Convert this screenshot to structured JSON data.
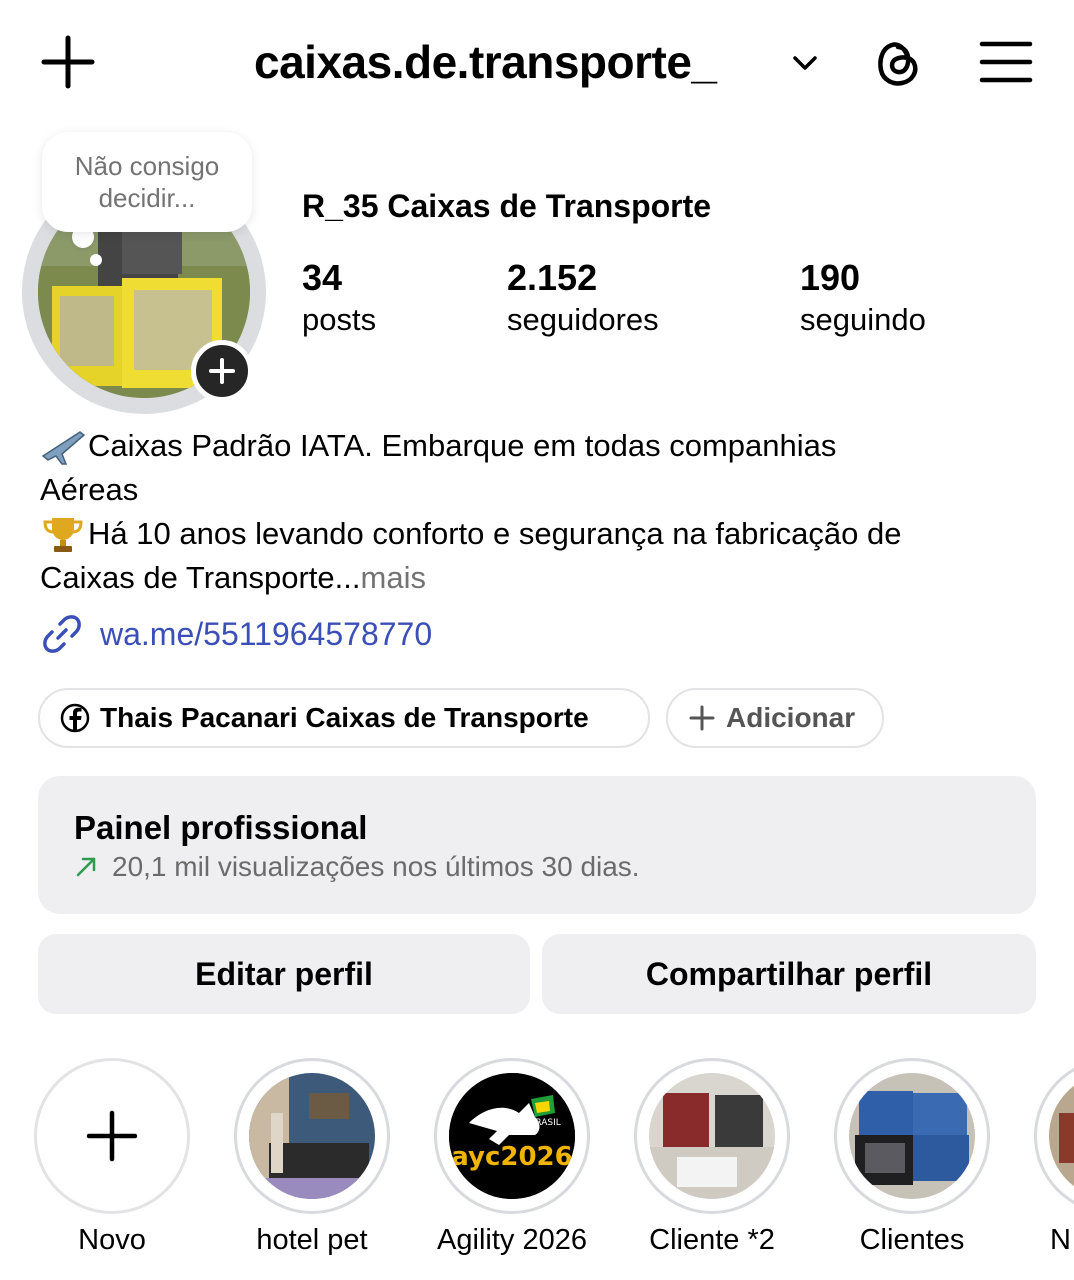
{
  "header": {
    "username": "caixas.de.transporte_",
    "icons": [
      "plus-icon",
      "chevron-down-icon",
      "threads-icon",
      "menu-icon"
    ]
  },
  "profile": {
    "note": "Não consigo decidir...",
    "display_name": "R_35 Caixas de Transporte",
    "stats": [
      {
        "value": "34",
        "label": "posts"
      },
      {
        "value": "2.152",
        "label": "seguidores"
      },
      {
        "value": "190",
        "label": "seguindo"
      }
    ]
  },
  "bio": {
    "line1": "Caixas Padrão IATA. Embarque em todas companhias",
    "line2": "Aéreas",
    "line3": "Há 10 anos levando conforto e segurança na fabricação de",
    "line4": "Caixas de Transporte...",
    "more": " mais",
    "link": "wa.me/5511964578770"
  },
  "chips": {
    "facebook": "Thais Pacanari Caixas de Transporte",
    "add": "Adicionar"
  },
  "panel": {
    "title": "Painel profissional",
    "subtitle": "20,1 mil visualizações nos últimos 30 dias."
  },
  "buttons": {
    "edit": "Editar perfil",
    "share": "Compartilhar perfil"
  },
  "highlights": [
    {
      "label": "Novo"
    },
    {
      "label": "hotel pet"
    },
    {
      "label": "Agility 2026",
      "badge_text": "ayc2026",
      "badge_sub": "BRASIL"
    },
    {
      "label": "Cliente *2"
    },
    {
      "label": "Clientes"
    },
    {
      "label": "N"
    }
  ],
  "colors": {
    "link": "#3b4fb8",
    "panel_bg": "#efeff1",
    "muted": "#737373",
    "trend": "#2e9b4e"
  }
}
